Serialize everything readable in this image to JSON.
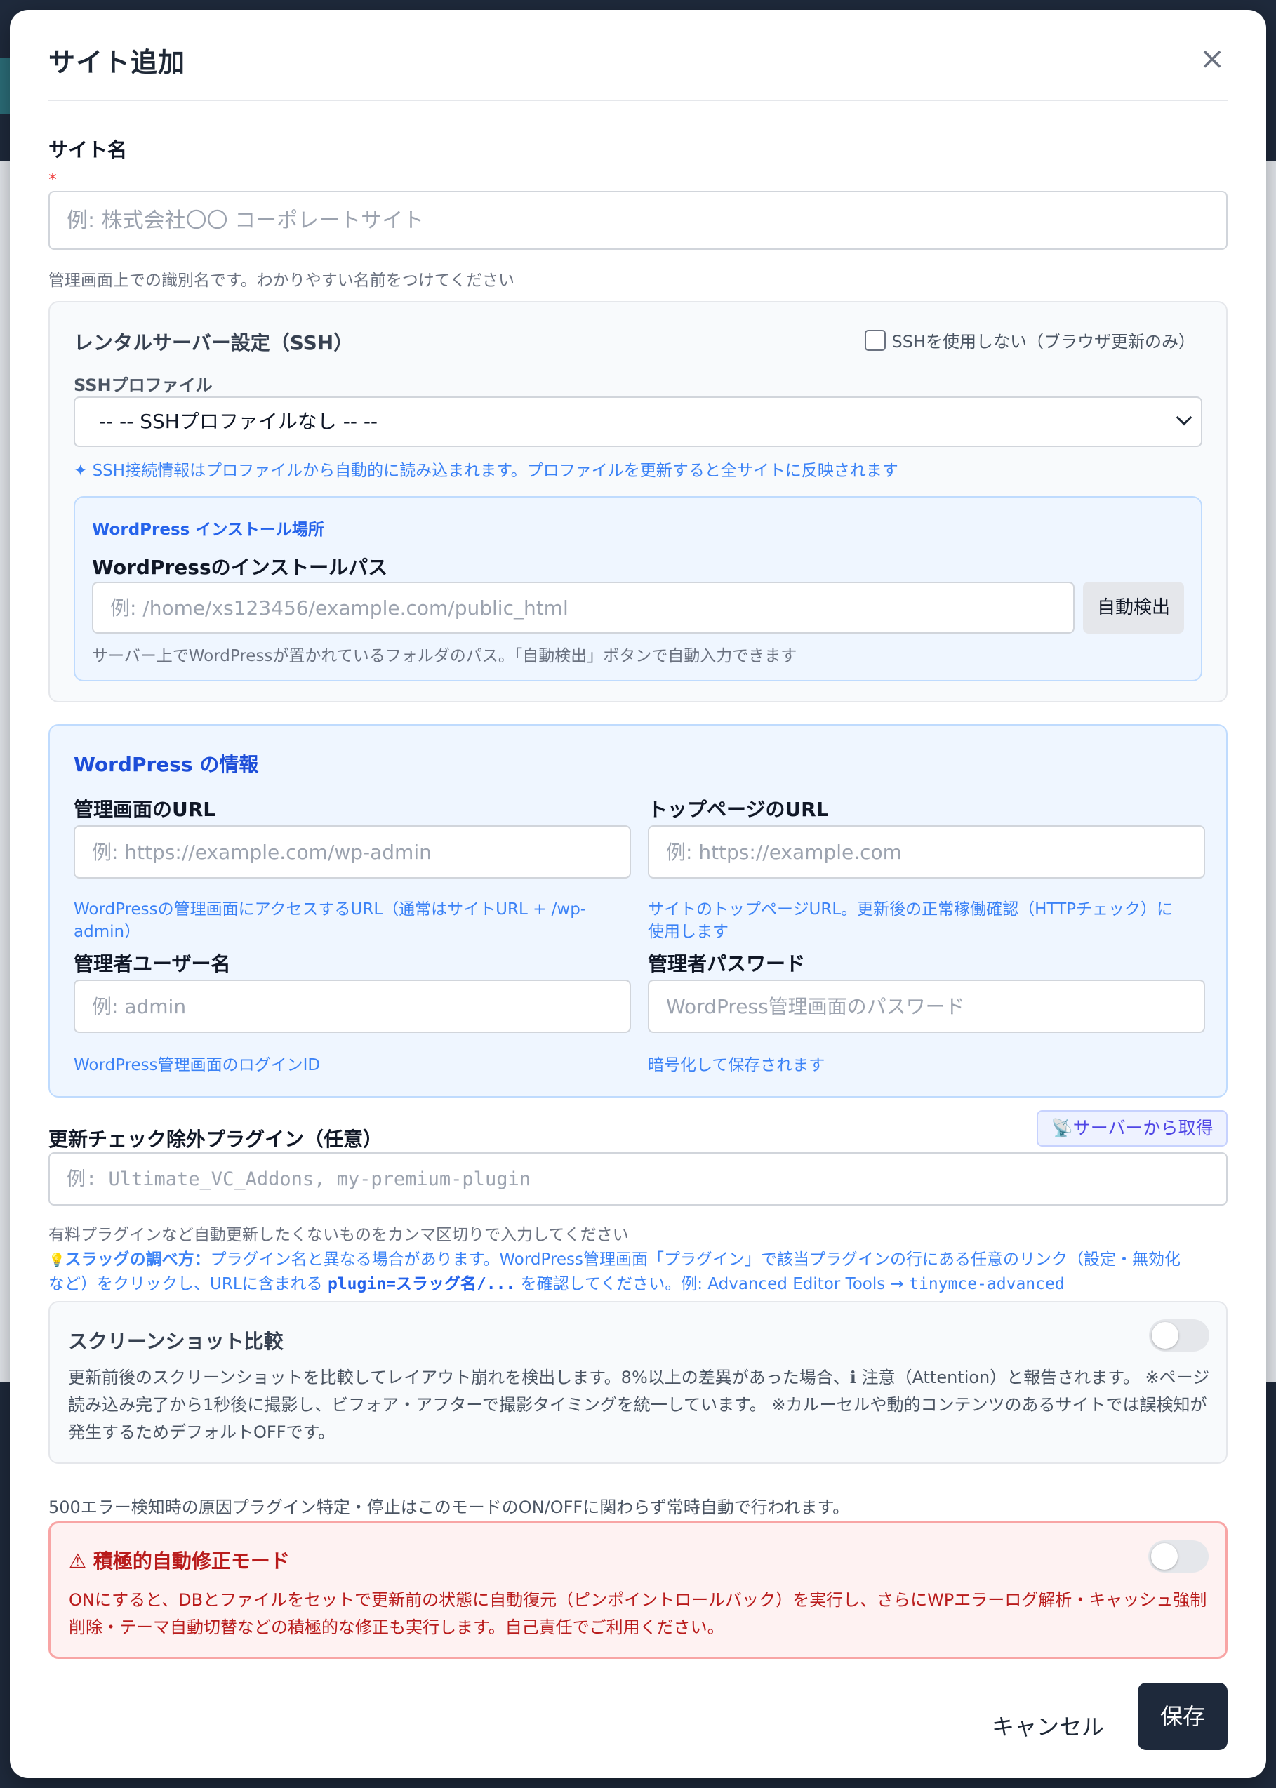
{
  "modal": {
    "title": "サイト追加",
    "close_symbol": "×"
  },
  "site_name": {
    "label": "サイト名",
    "required_mark": "*",
    "placeholder": "例: 株式会社〇〇 コーポレートサイト",
    "value": "",
    "hint": "管理画面上での識別名です。わかりやすい名前をつけてください"
  },
  "ssh": {
    "title": "レンタルサーバー設定（SSH）",
    "no_ssh_label": "SSHを使用しない（ブラウザ更新のみ）",
    "no_ssh_checked": false,
    "profile_label": "SSHプロファイル",
    "profile_selected": "-- -- SSHプロファイルなし -- --",
    "profile_hint": "✦ SSH接続情報はプロファイルから自動的に読み込まれます。プロファイルを更新すると全サイトに反映されます",
    "install": {
      "section_label": "WordPress インストール場所",
      "path_label": "WordPressのインストールパス",
      "path_placeholder": "例: /home/xs123456/example.com/public_html",
      "path_value": "",
      "detect_button": "自動検出",
      "hint": "サーバー上でWordPressが置かれているフォルダのパス。「自動検出」ボタンで自動入力できます"
    }
  },
  "wp_info": {
    "title": "WordPress の情報",
    "admin_url": {
      "label": "管理画面のURL",
      "placeholder": "例: https://example.com/wp-admin",
      "hint_line1": "WordPressの管理画面にアクセスするURL（通常はサイトURL + /wp-",
      "hint_line2": "admin）"
    },
    "top_url": {
      "label": "トップページのURL",
      "placeholder": "例: https://example.com",
      "hint_line1": "サイトのトップページURL。更新後の正常稼働確認（HTTPチェック）に",
      "hint_line2": "使用します"
    },
    "admin_user": {
      "label": "管理者ユーザー名",
      "placeholder": "例: admin",
      "hint": "WordPress管理画面のログインID"
    },
    "admin_pass": {
      "label": "管理者パスワード",
      "placeholder": "WordPress管理画面のパスワード",
      "hint": "暗号化して保存されます"
    }
  },
  "exclude_plugins": {
    "label": "更新チェック除外プラグイン（任意）",
    "fetch_button": "サーバーから取得",
    "placeholder": "例: Ultimate_VC_Addons, my-premium-plugin",
    "hint": "有料プラグインなど自動更新したくないものをカンマ区切りで入力してください",
    "tip_icon": "💡",
    "tip_bold": "スラッグの調べ方：",
    "tip_text1": "プラグイン名と異なる場合があります。WordPress管理画面「プラグイン」で該当プラグインの行にある任意のリンク（設定・無効化",
    "tip_text2a": "など）をクリックし、URLに含まれる ",
    "tip_code1": "plugin=スラッグ名/...",
    "tip_text2b": " を確認してください。例: Advanced Editor Tools → ",
    "tip_code2": "tinymce-advanced"
  },
  "screenshot": {
    "title": "スクリーンショット比較",
    "enabled": false,
    "desc_line1": "更新前後のスクリーンショットを比較してレイアウト崩れを検出します。8%以上の差異があった場合、ℹ 注意（Attention）と報告されます。 ※ページ",
    "desc_line2": "読み込み完了から1秒後に撮影し、ビフォア・アフターで撮影タイミングを統一しています。 ※カルーセルや動的コンテンツのあるサイトでは誤検知が",
    "desc_line3": "発生するためデフォルトOFFです。"
  },
  "note_500": "500エラー検知時の原因プラグイン特定・停止はこのモードのON/OFFに関わらず常時自動で行われます。",
  "aggressive": {
    "title": "⚠ 積極的自動修正モード",
    "enabled": false,
    "desc_line1": "ONにすると、DBとファイルをセットで更新前の状態に自動復元（ピンポイントロールバック）を実行し、さらにWPエラーログ解析・キャッシュ強制",
    "desc_line2": "削除・テーマ自動切替などの積極的な修正も実行します。自己責任でご利用ください。"
  },
  "footer": {
    "cancel": "キャンセル",
    "save": "保存"
  }
}
